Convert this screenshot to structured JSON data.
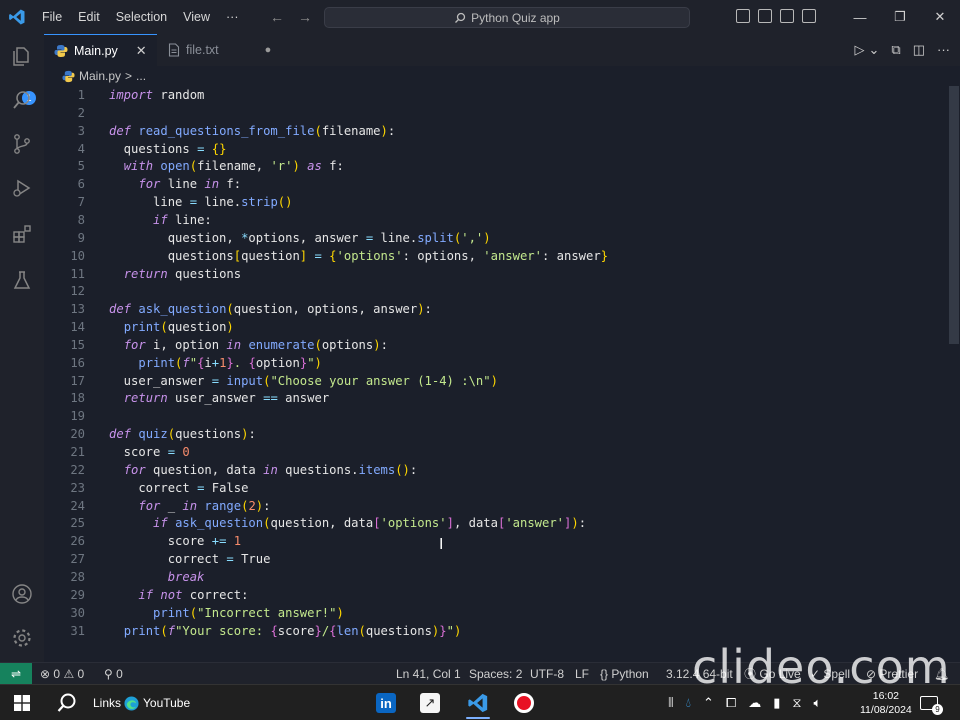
{
  "titlebar": {
    "menu": [
      "File",
      "Edit",
      "Selection",
      "View",
      "···"
    ],
    "search_text": "Python Quiz app",
    "win_controls": [
      "—",
      "❐",
      "✕"
    ]
  },
  "activity": {
    "badge": "1"
  },
  "tabs": [
    {
      "label": "Main.py",
      "active": true
    },
    {
      "label": "file.txt",
      "active": false
    }
  ],
  "breadcrumb": {
    "file": "Main.py",
    "sep": ">",
    "rest": "..."
  },
  "editor": {
    "lines": [
      {
        "n": "1",
        "t": [
          [
            "kw",
            "import"
          ],
          [
            "c",
            " random"
          ]
        ]
      },
      {
        "n": "2",
        "t": []
      },
      {
        "n": "3",
        "t": [
          [
            "kw",
            "def"
          ],
          [
            "c",
            " "
          ],
          [
            "fn",
            "read_questions_from_file"
          ],
          [
            "br1",
            "("
          ],
          [
            "c",
            "filename"
          ],
          [
            "br1",
            ")"
          ],
          [
            "c",
            ":"
          ]
        ]
      },
      {
        "n": "4",
        "t": [
          [
            "c",
            "  questions "
          ],
          [
            "op",
            "="
          ],
          [
            "c",
            " "
          ],
          [
            "br1",
            "{}"
          ]
        ]
      },
      {
        "n": "5",
        "t": [
          [
            "c",
            "  "
          ],
          [
            "kw",
            "with"
          ],
          [
            "c",
            " "
          ],
          [
            "bi",
            "open"
          ],
          [
            "br1",
            "("
          ],
          [
            "c",
            "filename, "
          ],
          [
            "str",
            "'r'"
          ],
          [
            "br1",
            ")"
          ],
          [
            "c",
            " "
          ],
          [
            "kw",
            "as"
          ],
          [
            "c",
            " f:"
          ]
        ]
      },
      {
        "n": "6",
        "t": [
          [
            "c",
            "    "
          ],
          [
            "kw",
            "for"
          ],
          [
            "c",
            " line "
          ],
          [
            "kw",
            "in"
          ],
          [
            "c",
            " f:"
          ]
        ]
      },
      {
        "n": "7",
        "t": [
          [
            "c",
            "      line "
          ],
          [
            "op",
            "="
          ],
          [
            "c",
            " line."
          ],
          [
            "fn",
            "strip"
          ],
          [
            "br1",
            "()"
          ]
        ]
      },
      {
        "n": "8",
        "t": [
          [
            "c",
            "      "
          ],
          [
            "kw",
            "if"
          ],
          [
            "c",
            " line:"
          ]
        ]
      },
      {
        "n": "9",
        "t": [
          [
            "c",
            "        question, "
          ],
          [
            "op",
            "*"
          ],
          [
            "c",
            "options, answer "
          ],
          [
            "op",
            "="
          ],
          [
            "c",
            " line."
          ],
          [
            "fn",
            "split"
          ],
          [
            "br1",
            "("
          ],
          [
            "str",
            "','"
          ],
          [
            "br1",
            ")"
          ]
        ]
      },
      {
        "n": "10",
        "t": [
          [
            "c",
            "        questions"
          ],
          [
            "br1",
            "["
          ],
          [
            "c",
            "question"
          ],
          [
            "br1",
            "]"
          ],
          [
            "c",
            " "
          ],
          [
            "op",
            "="
          ],
          [
            "c",
            " "
          ],
          [
            "br1",
            "{"
          ],
          [
            "str",
            "'options'"
          ],
          [
            "c",
            ": options, "
          ],
          [
            "str",
            "'answer'"
          ],
          [
            "c",
            ": answer"
          ],
          [
            "br1",
            "}"
          ]
        ]
      },
      {
        "n": "11",
        "t": [
          [
            "c",
            "  "
          ],
          [
            "kw",
            "return"
          ],
          [
            "c",
            " questions"
          ]
        ]
      },
      {
        "n": "12",
        "t": []
      },
      {
        "n": "13",
        "t": [
          [
            "kw",
            "def"
          ],
          [
            "c",
            " "
          ],
          [
            "fn",
            "ask_question"
          ],
          [
            "br1",
            "("
          ],
          [
            "c",
            "question, options, answer"
          ],
          [
            "br1",
            ")"
          ],
          [
            "c",
            ":"
          ]
        ]
      },
      {
        "n": "14",
        "t": [
          [
            "c",
            "  "
          ],
          [
            "bi",
            "print"
          ],
          [
            "br1",
            "("
          ],
          [
            "c",
            "question"
          ],
          [
            "br1",
            ")"
          ]
        ]
      },
      {
        "n": "15",
        "t": [
          [
            "c",
            "  "
          ],
          [
            "kw",
            "for"
          ],
          [
            "c",
            " i, option "
          ],
          [
            "kw",
            "in"
          ],
          [
            "c",
            " "
          ],
          [
            "bi",
            "enumerate"
          ],
          [
            "br1",
            "("
          ],
          [
            "c",
            "options"
          ],
          [
            "br1",
            ")"
          ],
          [
            "c",
            ":"
          ]
        ]
      },
      {
        "n": "16",
        "t": [
          [
            "c",
            "    "
          ],
          [
            "bi",
            "print"
          ],
          [
            "br1",
            "("
          ],
          [
            "kw",
            "f"
          ],
          [
            "str",
            "\""
          ],
          [
            "br2",
            "{"
          ],
          [
            "c",
            "i"
          ],
          [
            "op",
            "+"
          ],
          [
            "num",
            "1"
          ],
          [
            "br2",
            "}"
          ],
          [
            "str",
            ". "
          ],
          [
            "br2",
            "{"
          ],
          [
            "c",
            "option"
          ],
          [
            "br2",
            "}"
          ],
          [
            "str",
            "\""
          ],
          [
            "br1",
            ")"
          ]
        ]
      },
      {
        "n": "17",
        "t": [
          [
            "c",
            "  user_answer "
          ],
          [
            "op",
            "="
          ],
          [
            "c",
            " "
          ],
          [
            "bi",
            "input"
          ],
          [
            "br1",
            "("
          ],
          [
            "str",
            "\"Choose your answer (1-4) :\\n\""
          ],
          [
            "br1",
            ")"
          ]
        ]
      },
      {
        "n": "18",
        "t": [
          [
            "c",
            "  "
          ],
          [
            "kw",
            "return"
          ],
          [
            "c",
            " user_answer "
          ],
          [
            "op",
            "=="
          ],
          [
            "c",
            " answer"
          ]
        ]
      },
      {
        "n": "19",
        "t": []
      },
      {
        "n": "20",
        "t": [
          [
            "kw",
            "def"
          ],
          [
            "c",
            " "
          ],
          [
            "fn",
            "quiz"
          ],
          [
            "br1",
            "("
          ],
          [
            "c",
            "questions"
          ],
          [
            "br1",
            ")"
          ],
          [
            "c",
            ":"
          ]
        ]
      },
      {
        "n": "21",
        "t": [
          [
            "c",
            "  score "
          ],
          [
            "op",
            "="
          ],
          [
            "c",
            " "
          ],
          [
            "num",
            "0"
          ]
        ]
      },
      {
        "n": "22",
        "t": [
          [
            "c",
            "  "
          ],
          [
            "kw",
            "for"
          ],
          [
            "c",
            " question, data "
          ],
          [
            "kw",
            "in"
          ],
          [
            "c",
            " questions."
          ],
          [
            "fn",
            "items"
          ],
          [
            "br1",
            "()"
          ],
          [
            "c",
            ":"
          ]
        ]
      },
      {
        "n": "23",
        "t": [
          [
            "c",
            "    correct "
          ],
          [
            "op",
            "="
          ],
          [
            "c",
            " False"
          ]
        ]
      },
      {
        "n": "24",
        "t": [
          [
            "c",
            "    "
          ],
          [
            "kw",
            "for"
          ],
          [
            "c",
            " _ "
          ],
          [
            "kw",
            "in"
          ],
          [
            "c",
            " "
          ],
          [
            "bi",
            "range"
          ],
          [
            "br1",
            "("
          ],
          [
            "num",
            "2"
          ],
          [
            "br1",
            ")"
          ],
          [
            "c",
            ":"
          ]
        ]
      },
      {
        "n": "25",
        "t": [
          [
            "c",
            "      "
          ],
          [
            "kw",
            "if"
          ],
          [
            "c",
            " "
          ],
          [
            "fn",
            "ask_question"
          ],
          [
            "br1",
            "("
          ],
          [
            "c",
            "question, data"
          ],
          [
            "br2",
            "["
          ],
          [
            "str",
            "'options'"
          ],
          [
            "br2",
            "]"
          ],
          [
            "c",
            ", data"
          ],
          [
            "br2",
            "["
          ],
          [
            "str",
            "'answer'"
          ],
          [
            "br2",
            "]"
          ],
          [
            "br1",
            ")"
          ],
          [
            "c",
            ":"
          ]
        ]
      },
      {
        "n": "26",
        "t": [
          [
            "c",
            "        score "
          ],
          [
            "op",
            "+="
          ],
          [
            "c",
            " "
          ],
          [
            "num",
            "1"
          ]
        ]
      },
      {
        "n": "27",
        "t": [
          [
            "c",
            "        correct "
          ],
          [
            "op",
            "="
          ],
          [
            "c",
            " True"
          ]
        ]
      },
      {
        "n": "28",
        "t": [
          [
            "c",
            "        "
          ],
          [
            "kw",
            "break"
          ]
        ]
      },
      {
        "n": "29",
        "t": [
          [
            "c",
            "    "
          ],
          [
            "kw",
            "if"
          ],
          [
            "c",
            " "
          ],
          [
            "kw",
            "not"
          ],
          [
            "c",
            " correct:"
          ]
        ]
      },
      {
        "n": "30",
        "t": [
          [
            "c",
            "      "
          ],
          [
            "bi",
            "print"
          ],
          [
            "br1",
            "("
          ],
          [
            "str",
            "\"Incorrect answer!\""
          ],
          [
            "br1",
            ")"
          ]
        ]
      },
      {
        "n": "31",
        "t": [
          [
            "c",
            "  "
          ],
          [
            "bi",
            "print"
          ],
          [
            "br1",
            "("
          ],
          [
            "kw",
            "f"
          ],
          [
            "str",
            "\"Your score: "
          ],
          [
            "br2",
            "{"
          ],
          [
            "c",
            "score"
          ],
          [
            "br2",
            "}"
          ],
          [
            "str",
            "/"
          ],
          [
            "br2",
            "{"
          ],
          [
            "bi",
            "len"
          ],
          [
            "br1",
            "("
          ],
          [
            "c",
            "questions"
          ],
          [
            "br1",
            ")"
          ],
          [
            "br2",
            "}"
          ],
          [
            "str",
            "\""
          ],
          [
            "br1",
            ")"
          ]
        ]
      }
    ]
  },
  "statusbar": {
    "errors": "0",
    "warnings": "0",
    "ports": "0",
    "position": "Ln 41, Col 1",
    "spaces": "Spaces: 2",
    "encoding": "UTF-8",
    "eol": "LF",
    "language": "Python",
    "version": "3.12.4 64-bit",
    "golive": "Go Live",
    "spell": "Spell",
    "prettier": "Prettier"
  },
  "taskbar": {
    "links_label": "Links",
    "youtube_label": "YouTube",
    "time": "16:02",
    "date": "11/08/2024",
    "notif_count": "9"
  },
  "watermark": "clideo.com",
  "colors": {
    "accent": "#3794ff",
    "remote": "#16825d",
    "keyword": "#c792ea",
    "function": "#82aaff",
    "string": "#c3e88d",
    "number": "#f78c6c"
  }
}
